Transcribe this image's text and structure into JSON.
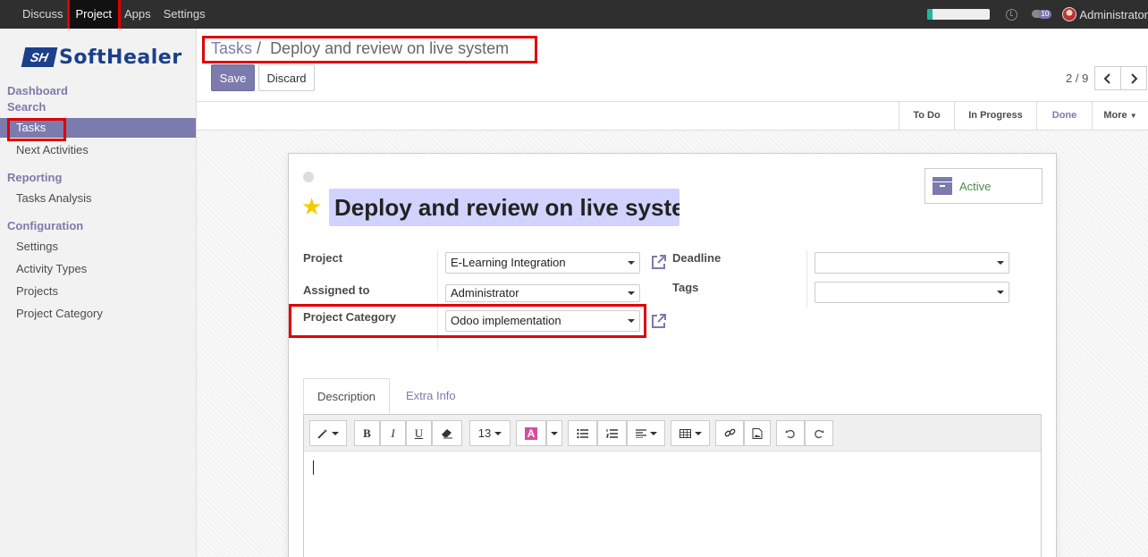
{
  "topbar": {
    "menu": [
      "Discuss",
      "Project",
      "Apps",
      "Settings"
    ],
    "active_menu": "Project",
    "progress": 0.08,
    "chat_count": "10",
    "user": "Administrator"
  },
  "sidebar": {
    "logo_mark": "SH",
    "logo_text": "SoftHealer",
    "dashboard": "Dashboard",
    "search": "Search",
    "tasks": "Tasks",
    "next_activities": "Next Activities",
    "reporting": "Reporting",
    "tasks_analysis": "Tasks Analysis",
    "configuration": "Configuration",
    "settings": "Settings",
    "activity_types": "Activity Types",
    "projects": "Projects",
    "project_category": "Project Category"
  },
  "control": {
    "breadcrumb_parent": "Tasks",
    "breadcrumb_sep": "/",
    "breadcrumb_current": "Deploy and review on live system",
    "save": "Save",
    "discard": "Discard",
    "pager": "2 / 9"
  },
  "stages": {
    "todo": "To Do",
    "in_progress": "In Progress",
    "done": "Done",
    "more": "More"
  },
  "form": {
    "title": "Deploy and review on live system",
    "active": "Active",
    "project_label": "Project",
    "project_value": "E-Learning Integration",
    "assigned_label": "Assigned to",
    "assigned_value": "Administrator",
    "category_label": "Project Category",
    "category_value": "Odoo implementation",
    "deadline_label": "Deadline",
    "deadline_value": "",
    "tags_label": "Tags",
    "tags_value": ""
  },
  "tabs": {
    "description": "Description",
    "extra_info": "Extra Info"
  },
  "editor": {
    "font_size": "13",
    "bold": "B",
    "italic": "I",
    "underline": "U",
    "color": "A"
  },
  "colors": {
    "accent": "#7c7bad",
    "highlight": "#e00000",
    "title_bg": "#d2d2ff"
  }
}
